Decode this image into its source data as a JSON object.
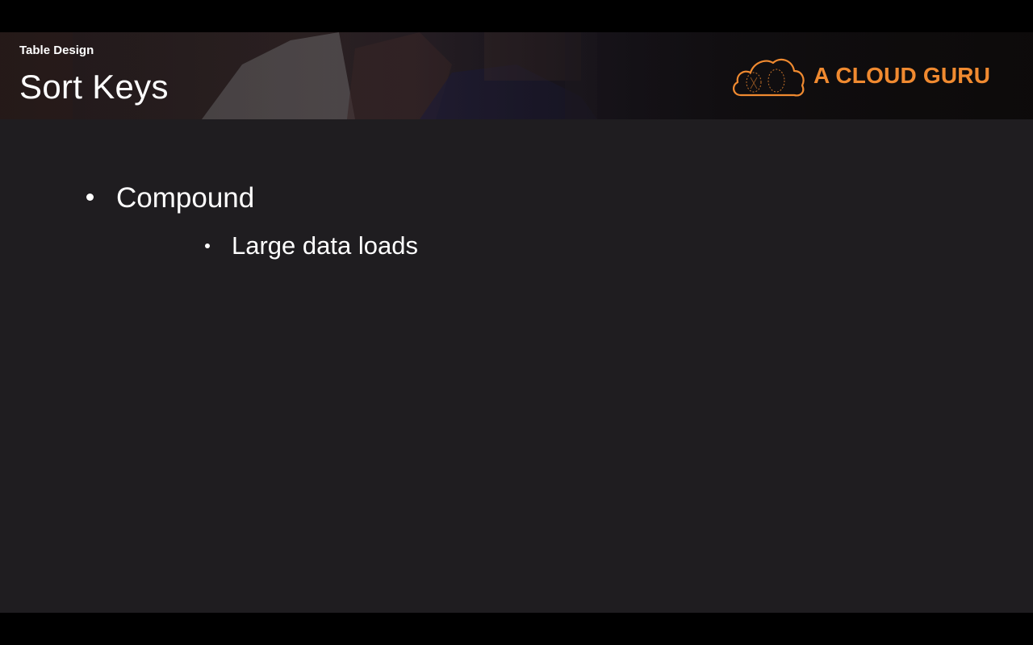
{
  "slide": {
    "section": "Table Design",
    "title": "Sort Keys",
    "bullets": [
      {
        "text": "Compound",
        "level": 1
      },
      {
        "text": "Large data loads",
        "level": 2
      }
    ]
  },
  "logo": {
    "text": "A CLOUD GURU",
    "icon": "cloud-logo-icon",
    "color": "#f08a30"
  },
  "colors": {
    "slide_background": "#1f1d20",
    "letterbox": "#000000",
    "text": "#ffffff"
  }
}
